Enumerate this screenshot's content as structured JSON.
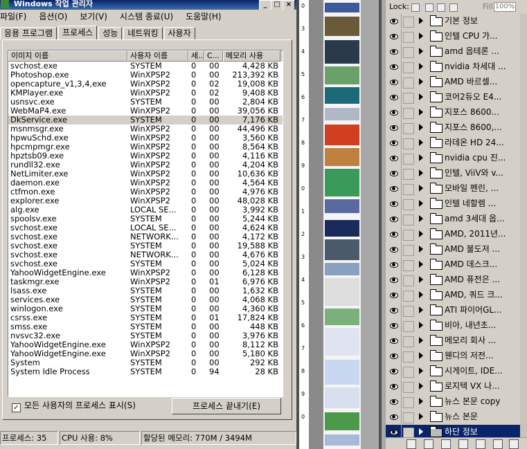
{
  "task_manager": {
    "title": "Windows 작업 관리자",
    "window_buttons": {
      "minimize": "_",
      "maximize": "□",
      "close": "×"
    },
    "menu": [
      "파일(F)",
      "옵션(O)",
      "보기(V)",
      "시스템 종료(U)",
      "도움말(H)"
    ],
    "tabs": [
      "응용 프로그램",
      "프로세스",
      "성능",
      "네트워킹",
      "사용자"
    ],
    "active_tab_index": 1,
    "columns": [
      "이미지 이름",
      "사용자 이름",
      "세...",
      "C...",
      "메모리 사용"
    ],
    "processes": [
      {
        "name": "svchost.exe",
        "user": "SYSTEM",
        "session": "0",
        "cpu": "00",
        "mem": "4,428 KB"
      },
      {
        "name": "Photoshop.exe",
        "user": "WinXPSP2",
        "session": "0",
        "cpu": "00",
        "mem": "213,392 KB"
      },
      {
        "name": "opencapture_v1,3,4,exe",
        "user": "WinXPSP2",
        "session": "0",
        "cpu": "02",
        "mem": "19,008 KB"
      },
      {
        "name": "KMPlayer.exe",
        "user": "WinXPSP2",
        "session": "0",
        "cpu": "02",
        "mem": "9,408 KB"
      },
      {
        "name": "usnsvc.exe",
        "user": "SYSTEM",
        "session": "0",
        "cpu": "00",
        "mem": "2,804 KB"
      },
      {
        "name": "WebMaP4.exe",
        "user": "WinXPSP2",
        "session": "0",
        "cpu": "00",
        "mem": "39,056 KB"
      },
      {
        "name": "DkService.exe",
        "user": "SYSTEM",
        "session": "0",
        "cpu": "00",
        "mem": "7,176 KB"
      },
      {
        "name": "msnmsgr.exe",
        "user": "WinXPSP2",
        "session": "0",
        "cpu": "00",
        "mem": "44,496 KB"
      },
      {
        "name": "hpwuSchd.exe",
        "user": "WinXPSP2",
        "session": "0",
        "cpu": "00",
        "mem": "3,560 KB"
      },
      {
        "name": "hpcmpmgr.exe",
        "user": "WinXPSP2",
        "session": "0",
        "cpu": "00",
        "mem": "8,564 KB"
      },
      {
        "name": "hpztsb09.exe",
        "user": "WinXPSP2",
        "session": "0",
        "cpu": "00",
        "mem": "4,116 KB"
      },
      {
        "name": "rundll32.exe",
        "user": "WinXPSP2",
        "session": "0",
        "cpu": "00",
        "mem": "4,204 KB"
      },
      {
        "name": "NetLimiter.exe",
        "user": "WinXPSP2",
        "session": "0",
        "cpu": "00",
        "mem": "10,636 KB"
      },
      {
        "name": "daemon.exe",
        "user": "WinXPSP2",
        "session": "0",
        "cpu": "00",
        "mem": "4,564 KB"
      },
      {
        "name": "ctfmon.exe",
        "user": "WinXPSP2",
        "session": "0",
        "cpu": "00",
        "mem": "4,976 KB"
      },
      {
        "name": "explorer.exe",
        "user": "WinXPSP2",
        "session": "0",
        "cpu": "00",
        "mem": "48,028 KB"
      },
      {
        "name": "alg.exe",
        "user": "LOCAL SE...",
        "session": "0",
        "cpu": "00",
        "mem": "3,992 KB"
      },
      {
        "name": "spoolsv.exe",
        "user": "SYSTEM",
        "session": "0",
        "cpu": "00",
        "mem": "5,244 KB"
      },
      {
        "name": "svchost.exe",
        "user": "LOCAL SE...",
        "session": "0",
        "cpu": "00",
        "mem": "4,624 KB"
      },
      {
        "name": "svchost.exe",
        "user": "NETWORK...",
        "session": "0",
        "cpu": "00",
        "mem": "4,172 KB"
      },
      {
        "name": "svchost.exe",
        "user": "SYSTEM",
        "session": "0",
        "cpu": "00",
        "mem": "19,588 KB"
      },
      {
        "name": "svchost.exe",
        "user": "NETWORK...",
        "session": "0",
        "cpu": "00",
        "mem": "4,676 KB"
      },
      {
        "name": "svchost.exe",
        "user": "SYSTEM",
        "session": "0",
        "cpu": "00",
        "mem": "5,024 KB"
      },
      {
        "name": "YahooWidgetEngine.exe",
        "user": "WinXPSP2",
        "session": "0",
        "cpu": "00",
        "mem": "6,128 KB"
      },
      {
        "name": "taskmgr.exe",
        "user": "WinXPSP2",
        "session": "0",
        "cpu": "01",
        "mem": "6,976 KB"
      },
      {
        "name": "lsass.exe",
        "user": "SYSTEM",
        "session": "0",
        "cpu": "00",
        "mem": "1,632 KB"
      },
      {
        "name": "services.exe",
        "user": "SYSTEM",
        "session": "0",
        "cpu": "00",
        "mem": "4,068 KB"
      },
      {
        "name": "winlogon.exe",
        "user": "SYSTEM",
        "session": "0",
        "cpu": "00",
        "mem": "4,360 KB"
      },
      {
        "name": "csrss.exe",
        "user": "SYSTEM",
        "session": "0",
        "cpu": "01",
        "mem": "17,824 KB"
      },
      {
        "name": "smss.exe",
        "user": "SYSTEM",
        "session": "0",
        "cpu": "00",
        "mem": "448 KB"
      },
      {
        "name": "nvsvc32.exe",
        "user": "SYSTEM",
        "session": "0",
        "cpu": "00",
        "mem": "3,976 KB"
      },
      {
        "name": "YahooWidgetEngine.exe",
        "user": "WinXPSP2",
        "session": "0",
        "cpu": "00",
        "mem": "8,112 KB"
      },
      {
        "name": "YahooWidgetEngine.exe",
        "user": "WinXPSP2",
        "session": "0",
        "cpu": "00",
        "mem": "5,180 KB"
      },
      {
        "name": "System",
        "user": "SYSTEM",
        "session": "0",
        "cpu": "00",
        "mem": "292 KB"
      },
      {
        "name": "System Idle Process",
        "user": "SYSTEM",
        "session": "0",
        "cpu": "94",
        "mem": "28 KB"
      }
    ],
    "selected_row_index": 6,
    "show_all_label": "모든 사용자의 프로세스 표시(S)",
    "show_all_checked": "✓",
    "end_process_label": "프로세스 끝내기(E)",
    "status": {
      "processes": "프로세스: 35",
      "cpu": "CPU 사용: 8%",
      "memory": "할당된 메모리: 770M / 3494M"
    }
  },
  "ruler_ticks": [
    "0",
    "3",
    "4",
    "5",
    "6",
    "7",
    "8",
    "9",
    "0",
    "1",
    "2",
    "3",
    "4",
    "5",
    "6",
    "7",
    "8",
    "9",
    "0"
  ],
  "layers_panel": {
    "lock_label": "Lock:",
    "fill_label": "Fill:",
    "fill_value": "100%",
    "layers": [
      "기본 정보",
      "인텔 CPU 가...",
      "amd 옵테론 ...",
      "nvidia 차세대 ...",
      "AMD 바르셀...",
      "코어2듀오 E4...",
      "지포스 8600...",
      "지포스 8600,...",
      "라데온 HD 24...",
      "nvidia cpu 진...",
      "인텔, ViiV와 v...",
      "모바일 펜린, ...",
      "인텔 네할렘 ...",
      "amd 3세대 옵...",
      "AMD, 2011년...",
      "AMD 불도저 ...",
      "AMD 데스크...",
      "AMD 퓨전은 ...",
      "AMD, 쿼드 크...",
      "ATI 파이어GL...",
      "비아, 내년초...",
      "메모리 회사 ...",
      "웬디의 저전...",
      "시게이트, IDE...",
      "로지텍 VX 나...",
      "뉴스 본문 copy",
      "뉴스 본문",
      "하단 정보"
    ],
    "selected_layer_index": 27
  },
  "colors": {
    "selection_blue": "#0a246a",
    "window_gray": "#d4d0c8"
  }
}
